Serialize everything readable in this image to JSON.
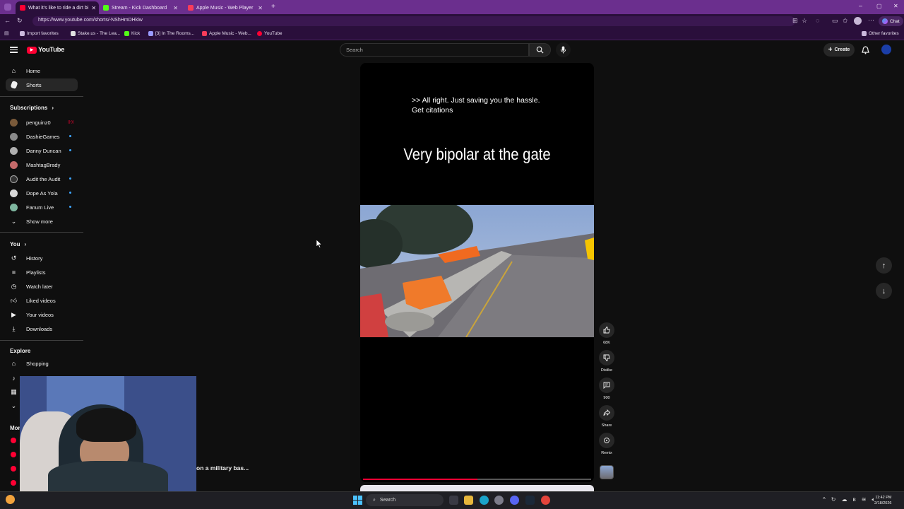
{
  "browser": {
    "tabs": [
      {
        "title": "What it's like to ride a dirt bi",
        "active": true
      },
      {
        "title": "Stream - Kick Dashboard",
        "active": false
      },
      {
        "title": "Apple Music - Web Player",
        "active": false
      }
    ],
    "url": "https://www.youtube.com/shorts/-NShHmDHkiw",
    "bookmarks": [
      "Import favorites",
      "Stake.us - The Lea...",
      "Kick",
      "[3] In The Rooms...",
      "Apple Music - Web...",
      "YouTube"
    ],
    "other_favorites": "Other favorites",
    "chat_label": "Chat"
  },
  "youtube": {
    "logo": "YouTube",
    "search_placeholder": "Search",
    "create_label": "Create",
    "nav": [
      {
        "label": "Home",
        "icon": "home-icon"
      },
      {
        "label": "Shorts",
        "icon": "shorts-icon",
        "selected": true
      }
    ],
    "subscriptions_heading": "Subscriptions",
    "subscriptions": [
      {
        "name": "penguinz0",
        "color": "#7a5a3a",
        "indicator": "live"
      },
      {
        "name": "DashieGames",
        "color": "#8a8a8a",
        "indicator": "dot"
      },
      {
        "name": "Danny Duncan",
        "color": "#b0b0b0",
        "indicator": "dot"
      },
      {
        "name": "MashtagBrady",
        "color": "#c56a6a",
        "indicator": "none"
      },
      {
        "name": "Audit the Audit",
        "color": "#333333",
        "indicator": "dot"
      },
      {
        "name": "Dope As Yola",
        "color": "#d8d8d8",
        "indicator": "dot"
      },
      {
        "name": "Fanum Live",
        "color": "#7fb7a0",
        "indicator": "dot"
      }
    ],
    "show_more": "Show more",
    "you_heading": "You",
    "you_items": [
      {
        "label": "History",
        "icon": "history-icon"
      },
      {
        "label": "Playlists",
        "icon": "playlists-icon"
      },
      {
        "label": "Watch later",
        "icon": "watch-later-icon"
      },
      {
        "label": "Liked videos",
        "icon": "like-icon"
      },
      {
        "label": "Your videos",
        "icon": "your-videos-icon"
      },
      {
        "label": "Downloads",
        "icon": "download-icon"
      }
    ],
    "explore_heading": "Explore",
    "explore_items": [
      {
        "label": "Shopping",
        "icon": "shopping-icon"
      }
    ],
    "more_heading_partial": "Mor"
  },
  "short": {
    "caption_line1": ">> All right. Just saving you the hassle.",
    "caption_line2": "Get citations",
    "overlay_title": "Very bipolar at the gate",
    "bottom_title_partial": "on a military bas...",
    "progress": 0.5,
    "actions": [
      {
        "label": "68K",
        "icon": "thumbs-up-icon"
      },
      {
        "label": "Dislike",
        "icon": "thumbs-down-icon"
      },
      {
        "label": "900",
        "icon": "comment-icon"
      },
      {
        "label": "Share",
        "icon": "share-icon"
      },
      {
        "label": "Remix",
        "icon": "remix-icon"
      }
    ]
  },
  "taskbar": {
    "search": "Search",
    "time": "11:42 PM",
    "date": "2/18/2026"
  }
}
